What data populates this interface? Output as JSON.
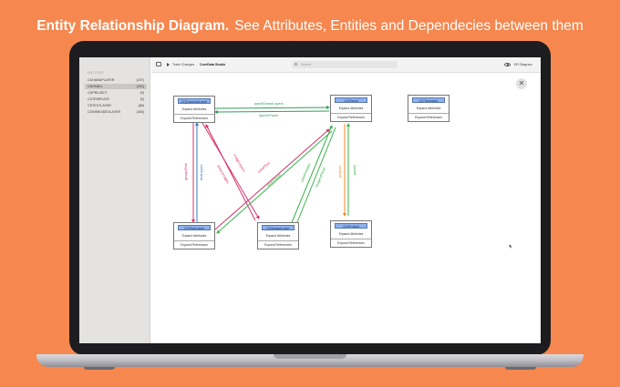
{
  "banner": {
    "title": "Entity Relationship Diagram.",
    "subtitle": "See Attributes, Entities and Dependecies between them"
  },
  "sidebar": {
    "section_title": "ENTITIES",
    "items": [
      {
        "label": "CDHANDPLAYER",
        "count": "(197)"
      },
      {
        "label": "CDPANEL",
        "count": "(203)"
      },
      {
        "label": "CDPROJECT",
        "count": "(9)"
      },
      {
        "label": "CDTEMPLATE",
        "count": "(0)"
      },
      {
        "label": "CDTEXTLAYER",
        "count": "(88)"
      },
      {
        "label": "CDWEBVIDEOLAYER",
        "count": "(283)"
      }
    ]
  },
  "toolbar": {
    "track_changes": "Track Changes",
    "app_name": "CoreData Studio",
    "search_placeholder": "Search",
    "view_mode": "ER Diagram"
  },
  "canvas": {
    "close_symbol": "✕",
    "entities": [
      {
        "id": "drawn",
        "title": "CDDrawingLayer",
        "attributes": "Expand Attributes",
        "references": "Expand References"
      },
      {
        "id": "panel",
        "title": "CDPanel",
        "attributes": "Expand Attributes",
        "references": "Expand References"
      },
      {
        "id": "template",
        "title": "CDTemplate",
        "attributes": "Expand Attributes",
        "references": "Expand References"
      },
      {
        "id": "text",
        "title": "CDTextLayer",
        "attributes": "Expand Attributes",
        "references": "Expand References"
      },
      {
        "id": "image",
        "title": "CDImageLayer",
        "attributes": "Expand Attributes",
        "references": "Expand References"
      },
      {
        "id": "project",
        "title": "CDProject",
        "attributes": "Expand Attributes",
        "references": "Expand References"
      }
    ],
    "relationships": [
      {
        "label": "panelDrawnLayers",
        "color": "#2e9e57"
      },
      {
        "label": "layerInPanel",
        "color": "#2e9e57"
      },
      {
        "label": "groupsText",
        "color": "#d6336c"
      },
      {
        "label": "textLayers",
        "color": "#3a78c9"
      },
      {
        "label": "imageLayers",
        "color": "#d6336c"
      },
      {
        "label": "drawnImages",
        "color": "#d6336c"
      },
      {
        "label": "panelText",
        "color": "#d6336c"
      },
      {
        "label": "textInPanel",
        "color": "#38b34a"
      },
      {
        "label": "panelImages",
        "color": "#38b34a"
      },
      {
        "label": "imageInPanel",
        "color": "#38b34a"
      },
      {
        "label": "projects",
        "color": "#f08a24"
      },
      {
        "label": "panels",
        "color": "#38b34a"
      }
    ]
  }
}
